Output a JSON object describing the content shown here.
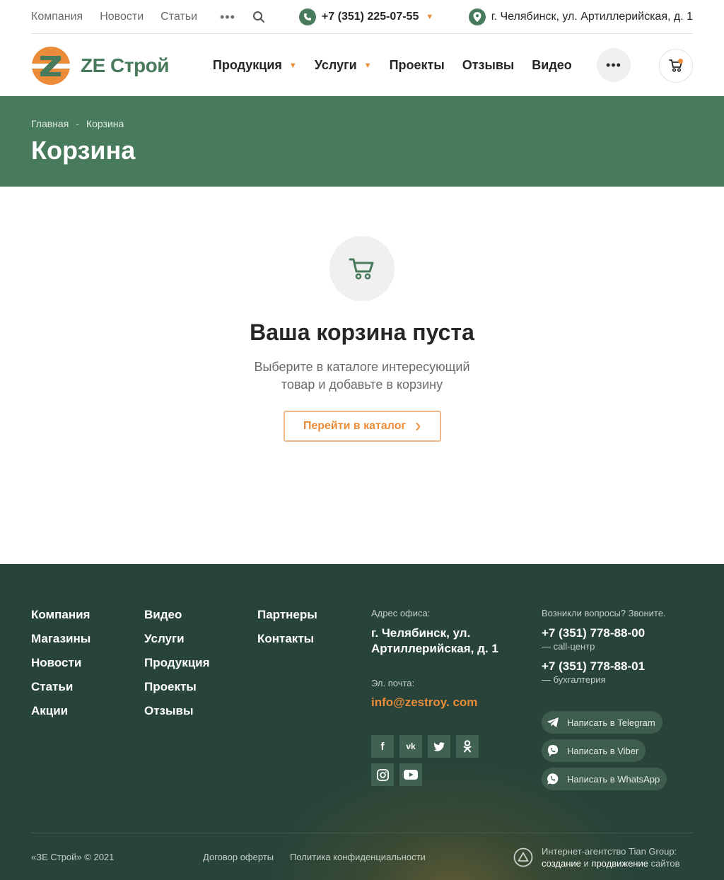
{
  "topbar": {
    "nav": [
      "Компания",
      "Новости",
      "Статьи"
    ],
    "phone": "+7 (351) 225-07-55",
    "address": "г. Челябинск, ул. Артиллерийская, д. 1"
  },
  "header": {
    "logo_text": "ZE Строй",
    "nav": {
      "products": "Продукция",
      "services": "Услуги",
      "projects": "Проекты",
      "reviews": "Отзывы",
      "video": "Видео"
    }
  },
  "banner": {
    "breadcrumb_home": "Главная",
    "breadcrumb_sep": "-",
    "breadcrumb_current": "Корзина",
    "title": "Корзина"
  },
  "empty_cart": {
    "title": "Ваша корзина пуста",
    "text_line1": "Выберите в каталоге интересующий",
    "text_line2": "товар и добавьте в корзину",
    "button": "Перейти в каталог"
  },
  "footer": {
    "col1": [
      "Компания",
      "Магазины",
      "Новости",
      "Статьи",
      "Акции"
    ],
    "col2": [
      "Видео",
      "Услуги",
      "Продукция",
      "Проекты",
      "Отзывы"
    ],
    "col3": [
      "Партнеры",
      "Контакты"
    ],
    "office_label": "Адрес офиса:",
    "office_line1": "г. Челябинск, ул.",
    "office_line2": "Артиллерийская, д. 1",
    "email_label": "Эл. почта:",
    "email": "info@zestroy. com",
    "questions_label": "Возникли вопросы? Звоните.",
    "phone1": "+7 (351) 778-88-00",
    "phone1_note": "— call-центр",
    "phone2": "+7 (351) 778-88-01",
    "phone2_note": "— бухгалтерия",
    "messengers": {
      "telegram": "Написать в Telegram",
      "viber": "Написать в Viber",
      "whatsapp": "Написать в WhatsApp"
    },
    "copyright": "«ЗЕ Строй» © 2021",
    "offer": "Договор оферты",
    "privacy": "Политика конфиденциальности",
    "agency_line1": "Интернет-агентство Tian Group:",
    "agency_create": "создание",
    "agency_and": " и ",
    "agency_promo": "продвижение",
    "agency_sites": " сайтов"
  },
  "colors": {
    "brand_green": "#487a5c",
    "accent_orange": "#ea8c3a",
    "footer_bg": "#28443a"
  }
}
